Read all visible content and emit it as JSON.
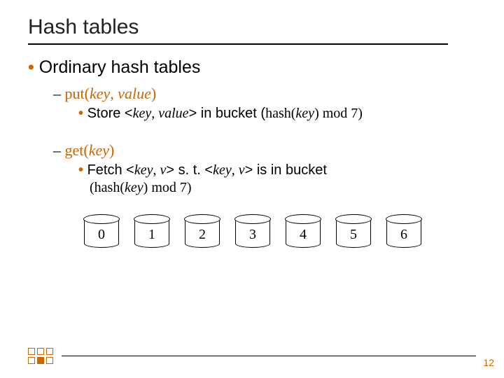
{
  "title": "Hash tables",
  "bullets": {
    "b1": "Ordinary hash tables",
    "put": {
      "label_pre": "put(",
      "label_arg1": "key",
      "label_sep": ", ",
      "label_arg2": "value",
      "label_post": ")",
      "store_pre": "Store <",
      "store_k": "key",
      "store_sep": ", ",
      "store_v": "value",
      "store_post": "> in bucket (",
      "store_hash": "hash",
      "store_paren_open": "(",
      "store_key2": "key",
      "store_paren_close": ") ",
      "store_mod": "mod",
      "store_tail": " 7)"
    },
    "get": {
      "label_pre": "get(",
      "label_arg": "key",
      "label_post": ")",
      "fetch_pre": "Fetch <",
      "fetch_k": "key",
      "fetch_sep": ", ",
      "fetch_v": "v",
      "fetch_mid": "> s. t. <",
      "fetch_k2": "key",
      "fetch_sep2": ", ",
      "fetch_v2": "v",
      "fetch_post": "> is in bucket",
      "fetch_line2_open": "(",
      "fetch_line2_hash": "hash",
      "fetch_line2_p1": "(",
      "fetch_line2_key": "key",
      "fetch_line2_p2": ") ",
      "fetch_line2_mod": "mod",
      "fetch_line2_tail": " 7)"
    }
  },
  "buckets": [
    "0",
    "1",
    "2",
    "3",
    "4",
    "5",
    "6"
  ],
  "page": "12"
}
